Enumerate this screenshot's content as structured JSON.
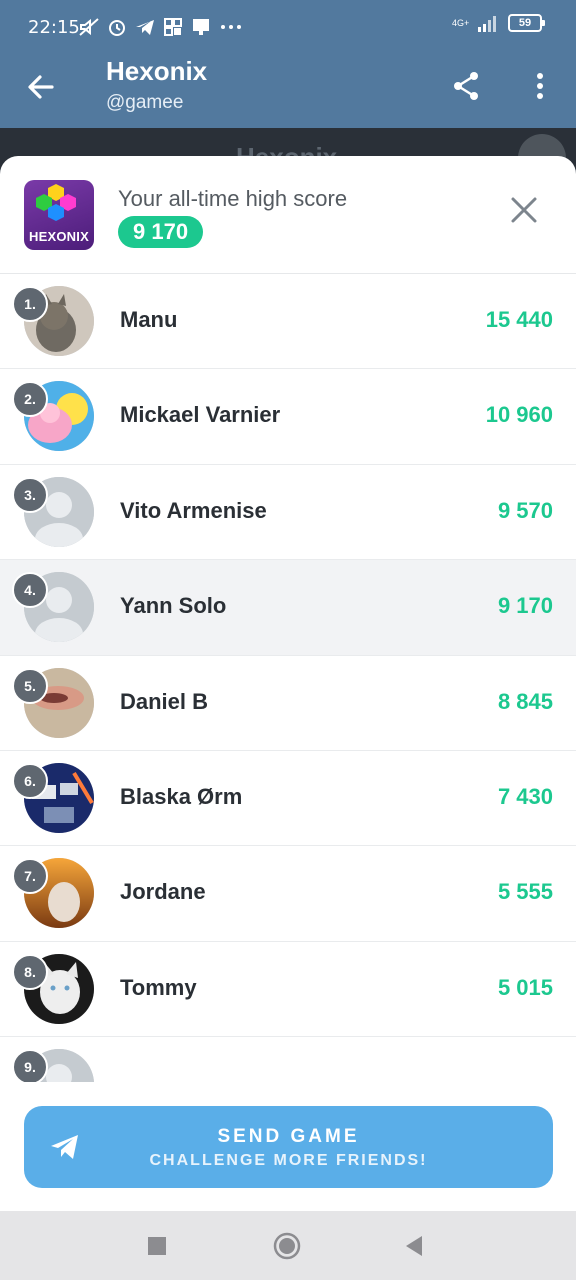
{
  "status_bar": {
    "time": "22:15",
    "network": "4G+",
    "battery": "59",
    "icons": [
      "mute-icon",
      "alarm-icon",
      "telegram-icon",
      "grid-icon",
      "notification-icon",
      "more-dots-icon"
    ]
  },
  "app_bar": {
    "title": "Hexonix",
    "subtitle": "@gamee",
    "icons": [
      "back-arrow-icon",
      "share-icon",
      "more-vertical-icon"
    ]
  },
  "game_strip": {
    "title": "Hexonix"
  },
  "sheet": {
    "logo_text": "HEXONIX",
    "high_score_label": "Your all-time high score",
    "high_score": "9 170"
  },
  "leaderboard": [
    {
      "rank": "1.",
      "name": "Manu",
      "score": "15 440",
      "avatar": "cat"
    },
    {
      "rank": "2.",
      "name": "Mickael Varnier",
      "score": "10 960",
      "avatar": "cartoon"
    },
    {
      "rank": "3.",
      "name": "Vito Armenise",
      "score": "9 570",
      "avatar": "default"
    },
    {
      "rank": "4.",
      "name": "Yann Solo",
      "score": "9 170",
      "avatar": "default",
      "highlight": true
    },
    {
      "rank": "5.",
      "name": "Daniel B",
      "score": "8 845",
      "avatar": "photo"
    },
    {
      "rank": "6.",
      "name": "Blaska Ørm",
      "score": "7 430",
      "avatar": "photo"
    },
    {
      "rank": "7.",
      "name": "Jordane",
      "score": "5 555",
      "avatar": "photo"
    },
    {
      "rank": "8.",
      "name": "Tommy",
      "score": "5 015",
      "avatar": "cat-white"
    },
    {
      "rank": "9.",
      "name": "",
      "score": "",
      "avatar": "default"
    }
  ],
  "send_button": {
    "title": "SEND GAME",
    "subtitle": "CHALLENGE MORE FRIENDS!"
  },
  "colors": {
    "header": "#52799e",
    "accent_green": "#1cc88f",
    "send_button": "#5aaee8",
    "rank_badge": "#5f6770"
  }
}
